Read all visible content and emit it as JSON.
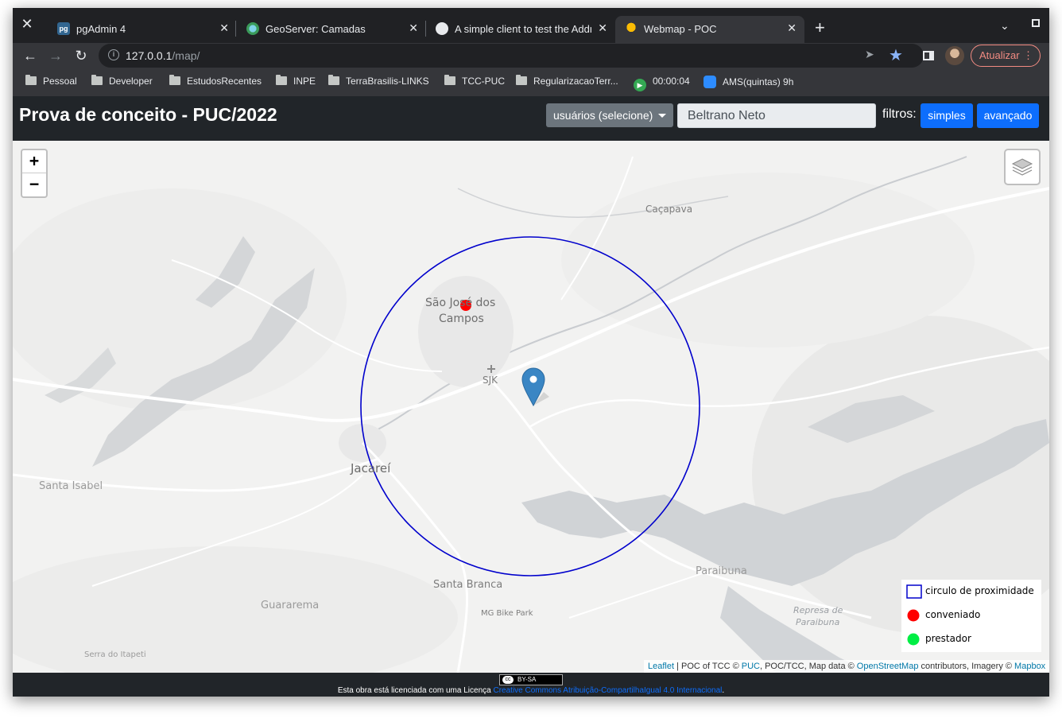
{
  "browser": {
    "tabs": [
      {
        "label": "pgAdmin 4",
        "icon": "pgadmin-icon"
      },
      {
        "label": "GeoServer: Camadas",
        "icon": "geoserver-icon"
      },
      {
        "label": "A simple client to test the Address",
        "icon": "globe-icon"
      },
      {
        "label": "Webmap - POC",
        "icon": "bulb-icon"
      }
    ],
    "url_host": "127.0.0.1",
    "url_path": "/map/",
    "update_label": "Atualizar",
    "bookmarks": [
      {
        "label": "Pessoal"
      },
      {
        "label": "Developer"
      },
      {
        "label": "EstudosRecentes"
      },
      {
        "label": "INPE"
      },
      {
        "label": "TerraBrasilis-LINKS"
      },
      {
        "label": "TCC-PUC"
      },
      {
        "label": "RegularizacaoTerr..."
      },
      {
        "label": "00:00:04"
      },
      {
        "label": "AMS(quintas) 9h"
      }
    ]
  },
  "app": {
    "title": "Prova de conceito - PUC/2022",
    "user_dropdown": "usuários (selecione)",
    "user_value": "Beltrano Neto",
    "filters_label": "filtros:",
    "btn_simple": "simples",
    "btn_advanced": "avançado"
  },
  "map": {
    "zoom_in": "+",
    "zoom_out": "−",
    "places": {
      "cacapava": "Caçapava",
      "sjc1": "São José dos",
      "sjc2": "Campos",
      "sjk": "SJK",
      "jacarei": "Jacareí",
      "santa_isabel": "Santa Isabel",
      "santa_branca": "Santa Branca",
      "mg_bike": "MG Bike Park",
      "guararema": "Guararema",
      "paraibuna": "Paraibuna",
      "represa1": "Represa de",
      "represa2": "Paraibuna",
      "serra": "Serra do Itapeti"
    },
    "legend": {
      "circle": "circulo de proximidade",
      "conveniado": "conveniado",
      "prestador": "prestador"
    },
    "colors": {
      "circle": "#0000cc",
      "conveniado": "#ff0000",
      "prestador": "#00ee44",
      "marker": "#3a86c4"
    },
    "attribution": {
      "leaflet": "Leaflet",
      "poc": " | POC of TCC © ",
      "puc": "PUC",
      "mid": ", POC/TCC, Map data © ",
      "osm": "OpenStreetMap",
      "tail": " contributors, Imagery © ",
      "mapbox": "Mapbox"
    }
  },
  "footer": {
    "badge": "BY-SA",
    "license_prefix": "Esta obra está licenciada com uma Licença ",
    "license_link": "Creative Commons Atribuição-CompartilhaIgual 4.0 Internacional",
    "license_suffix": "."
  }
}
